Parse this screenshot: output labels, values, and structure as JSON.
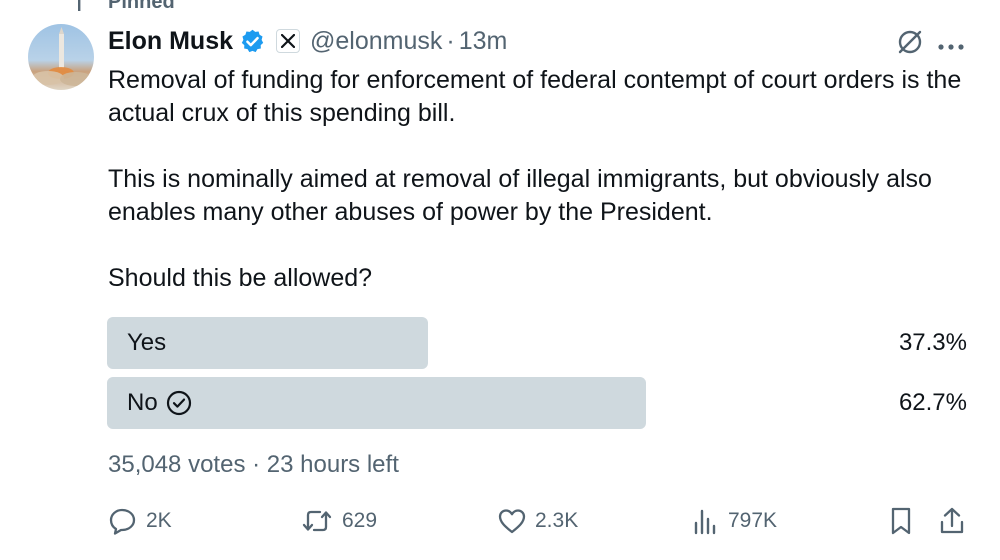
{
  "pinned_label": "Pinned",
  "author": {
    "name": "Elon Musk",
    "handle": "@elonmusk",
    "time": "13m"
  },
  "tweet": {
    "paragraphs": [
      "Removal of funding for enforcement of federal contempt of court orders is the actual crux of this spending bill.",
      "This is nominally aimed at removal of illegal immigrants, but obviously also enables many other abuses of power by the President.",
      "Should this be allowed?"
    ]
  },
  "poll": {
    "options": [
      {
        "label": "Yes",
        "percent_text": "37.3%",
        "fraction": 0.373,
        "selected": false
      },
      {
        "label": "No",
        "percent_text": "62.7%",
        "fraction": 0.627,
        "selected": true
      }
    ],
    "votes": "35,048 votes",
    "time_left": "23 hours left"
  },
  "actions": {
    "replies": "2K",
    "reposts": "629",
    "likes": "2.3K",
    "views": "797K"
  },
  "icons": [
    "pin-icon",
    "verified-badge-icon",
    "x-logo-icon",
    "grok-icon",
    "more-icon",
    "check-circle-icon",
    "reply-icon",
    "repost-icon",
    "like-icon",
    "views-icon",
    "bookmark-icon",
    "share-icon"
  ],
  "colors": {
    "verified": "#1d9bf0",
    "poll_bar": "#cfd9de",
    "secondary_text": "#536471"
  }
}
